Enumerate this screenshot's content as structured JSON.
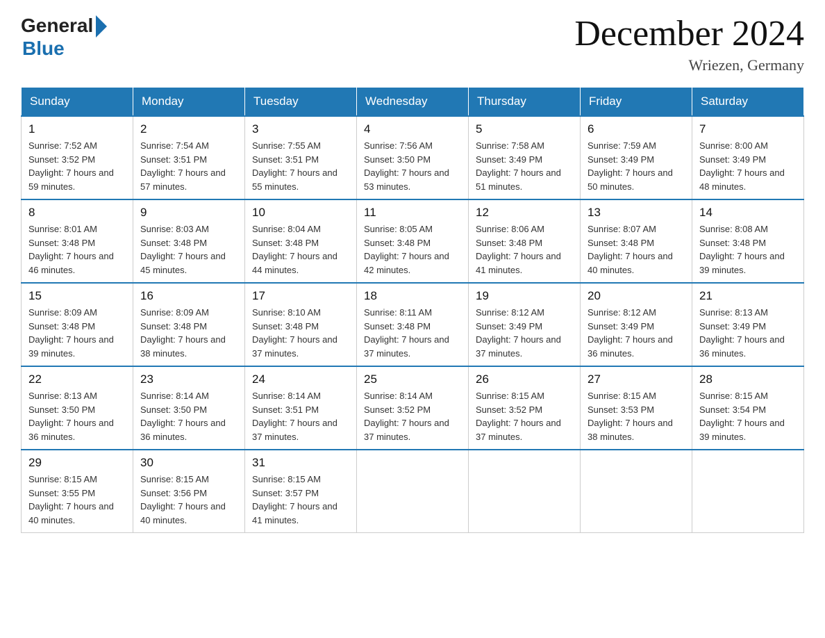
{
  "header": {
    "logo_general": "General",
    "logo_blue": "Blue",
    "month_title": "December 2024",
    "location": "Wriezen, Germany"
  },
  "days_of_week": [
    "Sunday",
    "Monday",
    "Tuesday",
    "Wednesday",
    "Thursday",
    "Friday",
    "Saturday"
  ],
  "weeks": [
    [
      {
        "day": "1",
        "sunrise": "7:52 AM",
        "sunset": "3:52 PM",
        "daylight": "7 hours and 59 minutes."
      },
      {
        "day": "2",
        "sunrise": "7:54 AM",
        "sunset": "3:51 PM",
        "daylight": "7 hours and 57 minutes."
      },
      {
        "day": "3",
        "sunrise": "7:55 AM",
        "sunset": "3:51 PM",
        "daylight": "7 hours and 55 minutes."
      },
      {
        "day": "4",
        "sunrise": "7:56 AM",
        "sunset": "3:50 PM",
        "daylight": "7 hours and 53 minutes."
      },
      {
        "day": "5",
        "sunrise": "7:58 AM",
        "sunset": "3:49 PM",
        "daylight": "7 hours and 51 minutes."
      },
      {
        "day": "6",
        "sunrise": "7:59 AM",
        "sunset": "3:49 PM",
        "daylight": "7 hours and 50 minutes."
      },
      {
        "day": "7",
        "sunrise": "8:00 AM",
        "sunset": "3:49 PM",
        "daylight": "7 hours and 48 minutes."
      }
    ],
    [
      {
        "day": "8",
        "sunrise": "8:01 AM",
        "sunset": "3:48 PM",
        "daylight": "7 hours and 46 minutes."
      },
      {
        "day": "9",
        "sunrise": "8:03 AM",
        "sunset": "3:48 PM",
        "daylight": "7 hours and 45 minutes."
      },
      {
        "day": "10",
        "sunrise": "8:04 AM",
        "sunset": "3:48 PM",
        "daylight": "7 hours and 44 minutes."
      },
      {
        "day": "11",
        "sunrise": "8:05 AM",
        "sunset": "3:48 PM",
        "daylight": "7 hours and 42 minutes."
      },
      {
        "day": "12",
        "sunrise": "8:06 AM",
        "sunset": "3:48 PM",
        "daylight": "7 hours and 41 minutes."
      },
      {
        "day": "13",
        "sunrise": "8:07 AM",
        "sunset": "3:48 PM",
        "daylight": "7 hours and 40 minutes."
      },
      {
        "day": "14",
        "sunrise": "8:08 AM",
        "sunset": "3:48 PM",
        "daylight": "7 hours and 39 minutes."
      }
    ],
    [
      {
        "day": "15",
        "sunrise": "8:09 AM",
        "sunset": "3:48 PM",
        "daylight": "7 hours and 39 minutes."
      },
      {
        "day": "16",
        "sunrise": "8:09 AM",
        "sunset": "3:48 PM",
        "daylight": "7 hours and 38 minutes."
      },
      {
        "day": "17",
        "sunrise": "8:10 AM",
        "sunset": "3:48 PM",
        "daylight": "7 hours and 37 minutes."
      },
      {
        "day": "18",
        "sunrise": "8:11 AM",
        "sunset": "3:48 PM",
        "daylight": "7 hours and 37 minutes."
      },
      {
        "day": "19",
        "sunrise": "8:12 AM",
        "sunset": "3:49 PM",
        "daylight": "7 hours and 37 minutes."
      },
      {
        "day": "20",
        "sunrise": "8:12 AM",
        "sunset": "3:49 PM",
        "daylight": "7 hours and 36 minutes."
      },
      {
        "day": "21",
        "sunrise": "8:13 AM",
        "sunset": "3:49 PM",
        "daylight": "7 hours and 36 minutes."
      }
    ],
    [
      {
        "day": "22",
        "sunrise": "8:13 AM",
        "sunset": "3:50 PM",
        "daylight": "7 hours and 36 minutes."
      },
      {
        "day": "23",
        "sunrise": "8:14 AM",
        "sunset": "3:50 PM",
        "daylight": "7 hours and 36 minutes."
      },
      {
        "day": "24",
        "sunrise": "8:14 AM",
        "sunset": "3:51 PM",
        "daylight": "7 hours and 37 minutes."
      },
      {
        "day": "25",
        "sunrise": "8:14 AM",
        "sunset": "3:52 PM",
        "daylight": "7 hours and 37 minutes."
      },
      {
        "day": "26",
        "sunrise": "8:15 AM",
        "sunset": "3:52 PM",
        "daylight": "7 hours and 37 minutes."
      },
      {
        "day": "27",
        "sunrise": "8:15 AM",
        "sunset": "3:53 PM",
        "daylight": "7 hours and 38 minutes."
      },
      {
        "day": "28",
        "sunrise": "8:15 AM",
        "sunset": "3:54 PM",
        "daylight": "7 hours and 39 minutes."
      }
    ],
    [
      {
        "day": "29",
        "sunrise": "8:15 AM",
        "sunset": "3:55 PM",
        "daylight": "7 hours and 40 minutes."
      },
      {
        "day": "30",
        "sunrise": "8:15 AM",
        "sunset": "3:56 PM",
        "daylight": "7 hours and 40 minutes."
      },
      {
        "day": "31",
        "sunrise": "8:15 AM",
        "sunset": "3:57 PM",
        "daylight": "7 hours and 41 minutes."
      },
      null,
      null,
      null,
      null
    ]
  ]
}
